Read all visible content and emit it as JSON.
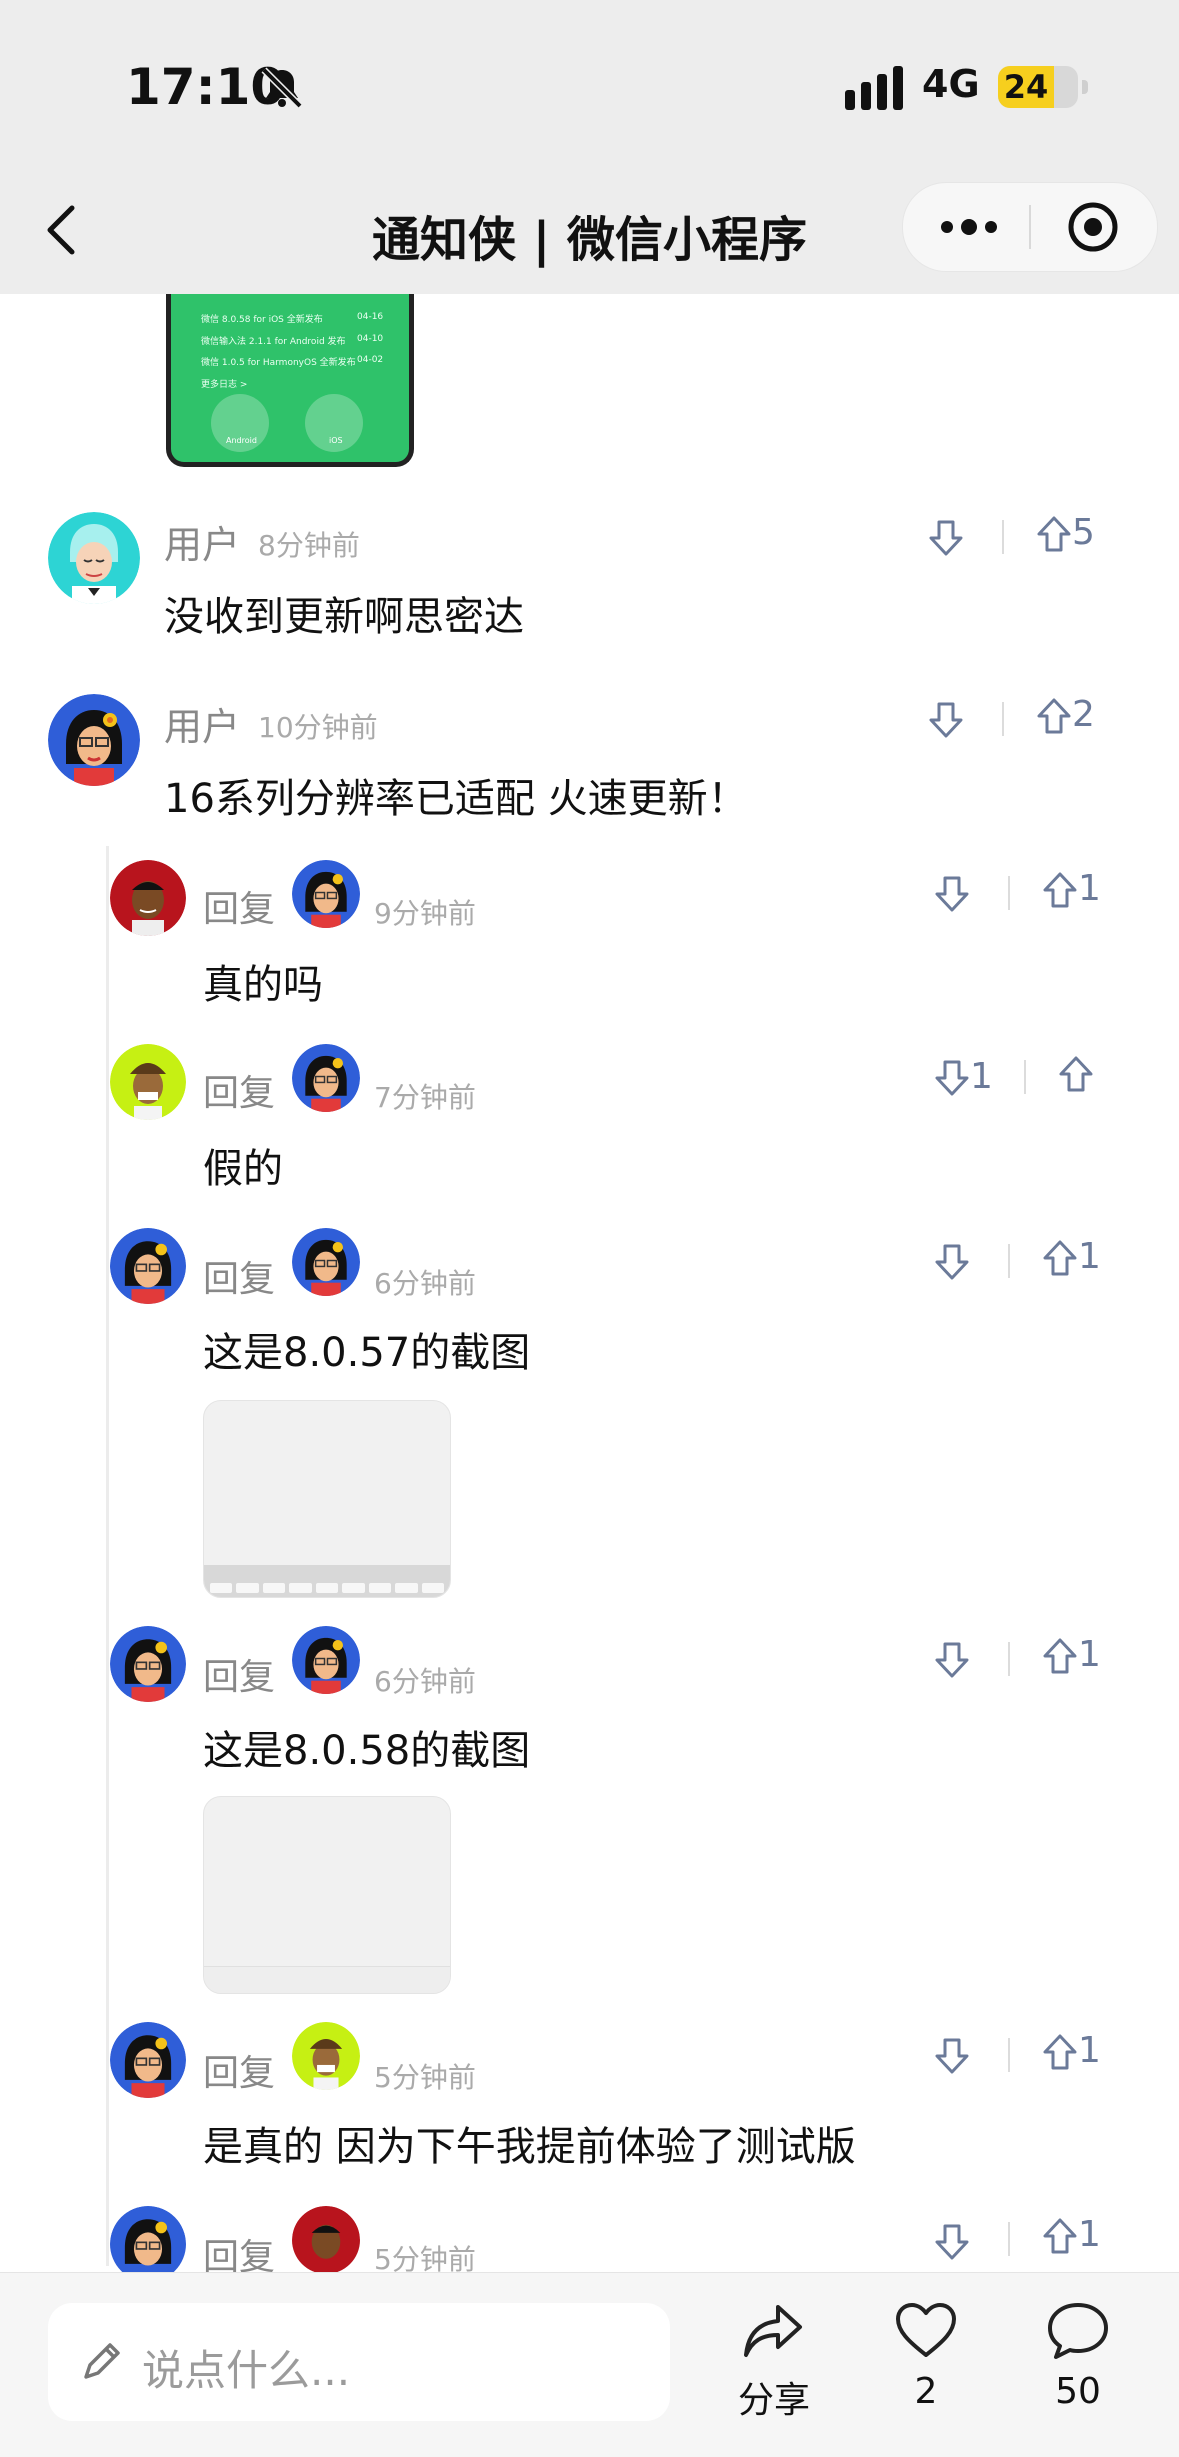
{
  "status_bar": {
    "time": "17:10",
    "network": "4G",
    "battery": "24"
  },
  "nav": {
    "title": "通知侠 | 微信小程序"
  },
  "preview_image": {
    "lines": [
      {
        "text": "微信 8.0.58 for iOS 全新发布",
        "date": "04-16"
      },
      {
        "text": "微信输入法 2.1.1 for Android 发布",
        "date": "04-10"
      },
      {
        "text": "微信 1.0.5 for HarmonyOS 全新发布",
        "date": "04-02"
      },
      {
        "text": "更多日志 >",
        "date": ""
      }
    ],
    "buttons": [
      "Android",
      "iOS"
    ]
  },
  "comments": [
    {
      "user": "用户",
      "time": "8分钟前",
      "text": "没收到更新啊思密达",
      "down": "",
      "up": "5"
    },
    {
      "user": "用户",
      "time": "10分钟前",
      "text": "16系列分辨率已适配 火速更新！",
      "down": "",
      "up": "2"
    }
  ],
  "replies": [
    {
      "label": "回复",
      "time": "9分钟前",
      "text": "真的吗",
      "down": "",
      "up": "1"
    },
    {
      "label": "回复",
      "time": "7分钟前",
      "text": "假的",
      "down": "1",
      "up": ""
    },
    {
      "label": "回复",
      "time": "6分钟前",
      "text": "这是8.0.57的截图",
      "down": "",
      "up": "1"
    },
    {
      "label": "回复",
      "time": "6分钟前",
      "text": "这是8.0.58的截图",
      "down": "",
      "up": "1"
    },
    {
      "label": "回复",
      "time": "5分钟前",
      "text": "是真的 因为下午我提前体验了测试版",
      "down": "",
      "up": "1"
    },
    {
      "label": "回复",
      "time": "5分钟前",
      "text": "",
      "down": "",
      "up": "1"
    }
  ],
  "bottom_bar": {
    "input_placeholder": "说点什么...",
    "share_label": "分享",
    "like_count": "2",
    "comment_count": "50"
  },
  "icons": [
    "bell-mute-icon",
    "signal-icon",
    "back-icon",
    "more-icon",
    "close-target-icon",
    "downvote-icon",
    "upvote-icon",
    "pencil-icon",
    "share-icon",
    "heart-icon",
    "comment-icon"
  ]
}
